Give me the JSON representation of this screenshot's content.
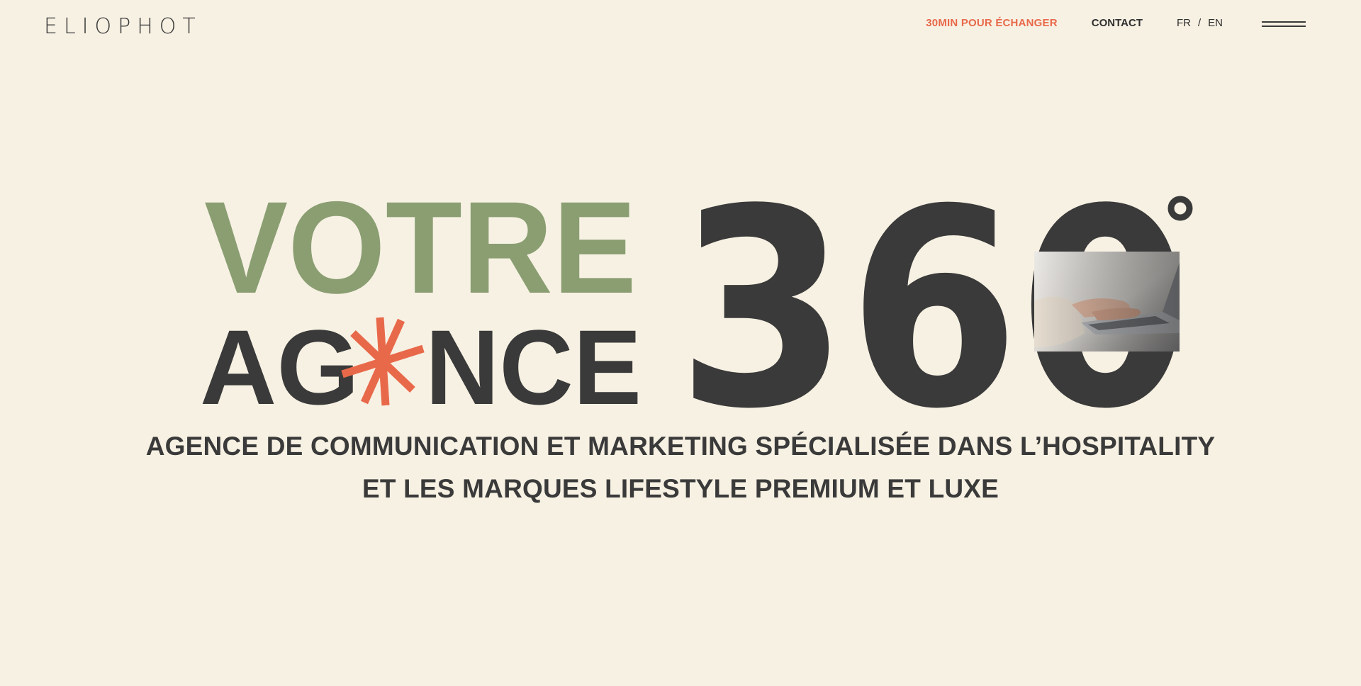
{
  "header": {
    "logo": "ELIOPHOT",
    "nav": {
      "cta_label": "30MIN POUR ÉCHANGER",
      "contact_label": "CONTACT",
      "lang_fr": "FR",
      "lang_sep": "/",
      "lang_en": "EN"
    },
    "menu_icon": "hamburger-icon"
  },
  "hero": {
    "line1": "VOTRE",
    "line2_before": "AG",
    "line2_after": "NCE",
    "big_number": "360",
    "degree_icon": "degree-ring-icon",
    "asterisk_icon": "asterisk-icon",
    "photo_subject": "hands-typing-on-laptop",
    "tagline_line1": "AGENCE DE COMMUNICATION ET MARKETING SPÉCIALISÉE DANS L’HOSPITALITY",
    "tagline_line2": "ET LES MARQUES LIFESTYLE PREMIUM ET LUXE"
  },
  "colors": {
    "background": "#f7f1e3",
    "dark": "#3a3a3a",
    "green": "#8a9e72",
    "accent": "#e8694a"
  }
}
